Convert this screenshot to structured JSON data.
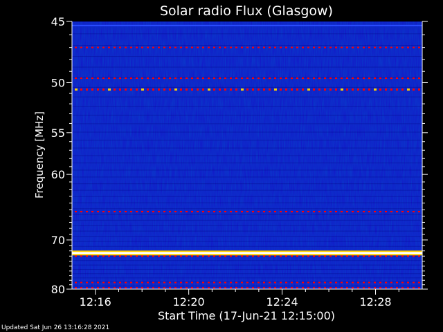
{
  "chart_data": {
    "type": "heatmap",
    "title": "Solar radio Flux (Glasgow)",
    "xlabel": "Start Time (17-Jun-21 12:15:00)",
    "ylabel": "Frequency [MHz]",
    "x_ticks": [
      "12:16",
      "12:20",
      "12:24",
      "12:28"
    ],
    "x_tick_minutes": [
      1,
      5,
      9,
      13
    ],
    "xlim_minutes": [
      0,
      15
    ],
    "y_ticks": [
      "45",
      "50",
      "55",
      "60",
      "70",
      "80"
    ],
    "y_tick_values": [
      45,
      50,
      55,
      60,
      70,
      80
    ],
    "ylim": [
      45,
      80
    ],
    "y_scale": "reciprocal",
    "grid": false,
    "colormap": [
      "#00007f",
      "#0000ff",
      "#2a4cff",
      "#ff0000",
      "#ffd200",
      "#ffffff"
    ],
    "background_color": "#1414c8",
    "bands": [
      {
        "freq_mhz": 45.3,
        "level": "low"
      },
      {
        "freq_mhz": 47.0,
        "level": "medium"
      },
      {
        "freq_mhz": 49.6,
        "level": "medium"
      },
      {
        "freq_mhz": 50.6,
        "level": "high"
      },
      {
        "freq_mhz": 65.3,
        "level": "medium"
      },
      {
        "freq_mhz": 72.4,
        "level": "saturated"
      },
      {
        "freq_mhz": 73.0,
        "level": "medium"
      },
      {
        "freq_mhz": 78.5,
        "level": "medium"
      },
      {
        "freq_mhz": 79.7,
        "level": "medium"
      }
    ]
  },
  "footer": {
    "updated": "Updated Sat Jun 26 13:16:28 2021"
  }
}
